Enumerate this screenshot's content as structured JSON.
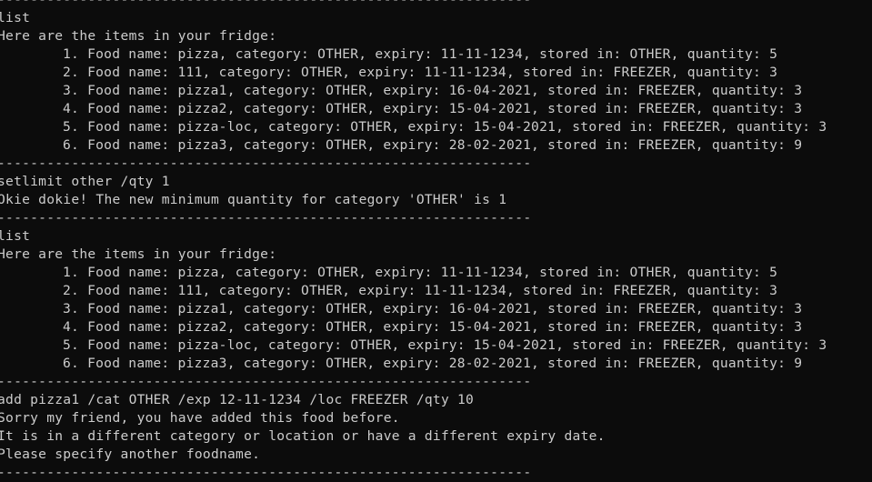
{
  "separator": "------------------------------------------------------------------",
  "blocks": [
    {
      "command": "list",
      "output": [
        "Here are the items in your fridge:"
      ],
      "items": [
        "1. Food name: pizza, category: OTHER, expiry: 11-11-1234, stored in: OTHER, quantity: 5",
        "2. Food name: 111, category: OTHER, expiry: 11-11-1234, stored in: FREEZER, quantity: 3",
        "3. Food name: pizza1, category: OTHER, expiry: 16-04-2021, stored in: FREEZER, quantity: 3",
        "4. Food name: pizza2, category: OTHER, expiry: 15-04-2021, stored in: FREEZER, quantity: 3",
        "5. Food name: pizza-loc, category: OTHER, expiry: 15-04-2021, stored in: FREEZER, quantity: 3",
        "6. Food name: pizza3, category: OTHER, expiry: 28-02-2021, stored in: FREEZER, quantity: 9"
      ]
    },
    {
      "command": "setlimit other /qty 1",
      "output": [
        "Okie dokie! The new minimum quantity for category 'OTHER' is 1"
      ],
      "items": []
    },
    {
      "command": "list",
      "output": [
        "Here are the items in your fridge:"
      ],
      "items": [
        "1. Food name: pizza, category: OTHER, expiry: 11-11-1234, stored in: OTHER, quantity: 5",
        "2. Food name: 111, category: OTHER, expiry: 11-11-1234, stored in: FREEZER, quantity: 3",
        "3. Food name: pizza1, category: OTHER, expiry: 16-04-2021, stored in: FREEZER, quantity: 3",
        "4. Food name: pizza2, category: OTHER, expiry: 15-04-2021, stored in: FREEZER, quantity: 3",
        "5. Food name: pizza-loc, category: OTHER, expiry: 15-04-2021, stored in: FREEZER, quantity: 3",
        "6. Food name: pizza3, category: OTHER, expiry: 28-02-2021, stored in: FREEZER, quantity: 9"
      ]
    },
    {
      "command": "add pizza1 /cat OTHER /exp 12-11-1234 /loc FREEZER /qty 10",
      "output": [
        "Sorry my friend, you have added this food before.",
        "It is in a different category or location or have a different expiry date.",
        "Please specify another foodname."
      ],
      "items": []
    }
  ]
}
